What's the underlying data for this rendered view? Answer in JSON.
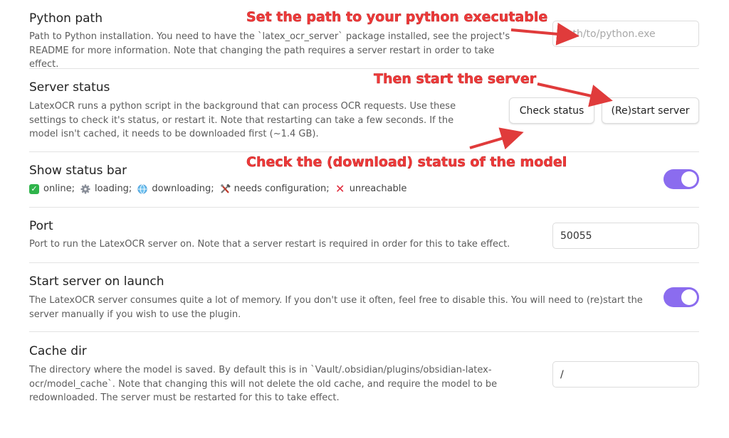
{
  "settings": {
    "python_path": {
      "name": "Python path",
      "desc": "Path to Python installation. You need to have the `latex_ocr_server` package installed, see the project's README for more information. Note that changing the path requires a server restart in order to take effect.",
      "placeholder": "path/to/python.exe"
    },
    "server_status": {
      "name": "Server status",
      "desc": "LatexOCR runs a python script in the background that can process OCR requests. Use these settings to check it's status, or restart it. Note that restarting can take a few seconds. If the model isn't cached, it needs to be downloaded first (~1.4 GB).",
      "check_label": "Check status",
      "restart_label": "(Re)start server"
    },
    "status_bar": {
      "name": "Show status bar",
      "legend": {
        "online": "online;",
        "loading": "loading;",
        "downloading": "downloading;",
        "needs_config": "needs configuration;",
        "unreachable": "unreachable"
      },
      "enabled": true
    },
    "port": {
      "name": "Port",
      "desc": "Port to run the LatexOCR server on. Note that a server restart is required in order for this to take effect.",
      "value": "50055"
    },
    "start_on_launch": {
      "name": "Start server on launch",
      "desc": "The LatexOCR server consumes quite a lot of memory. If you don't use it often, feel free to disable this. You will need to (re)start the server manually if you wish to use the plugin.",
      "enabled": true
    },
    "cache_dir": {
      "name": "Cache dir",
      "desc": "The directory where the model is saved. By default this is in `Vault/.obsidian/plugins/obsidian-latex-ocr/model_cache`. Note that changing this will not delete the old cache, and require the model to be redownloaded. The server must be restarted for this to take effect.",
      "value": "/"
    }
  },
  "annotations": {
    "python_path": "Set the path to your python executable",
    "start_server": "Then start the server",
    "check_status": "Check the (download) status of the model"
  },
  "colors": {
    "accent": "#8b6cef",
    "annotation": "#f03a3a",
    "online": "#2fb44b",
    "unreachable": "#e0293a"
  },
  "icons": {
    "online": "check-box-icon",
    "loading": "gear-icon",
    "downloading": "globe-icon",
    "needs_config": "tools-icon",
    "unreachable": "cross-icon"
  }
}
